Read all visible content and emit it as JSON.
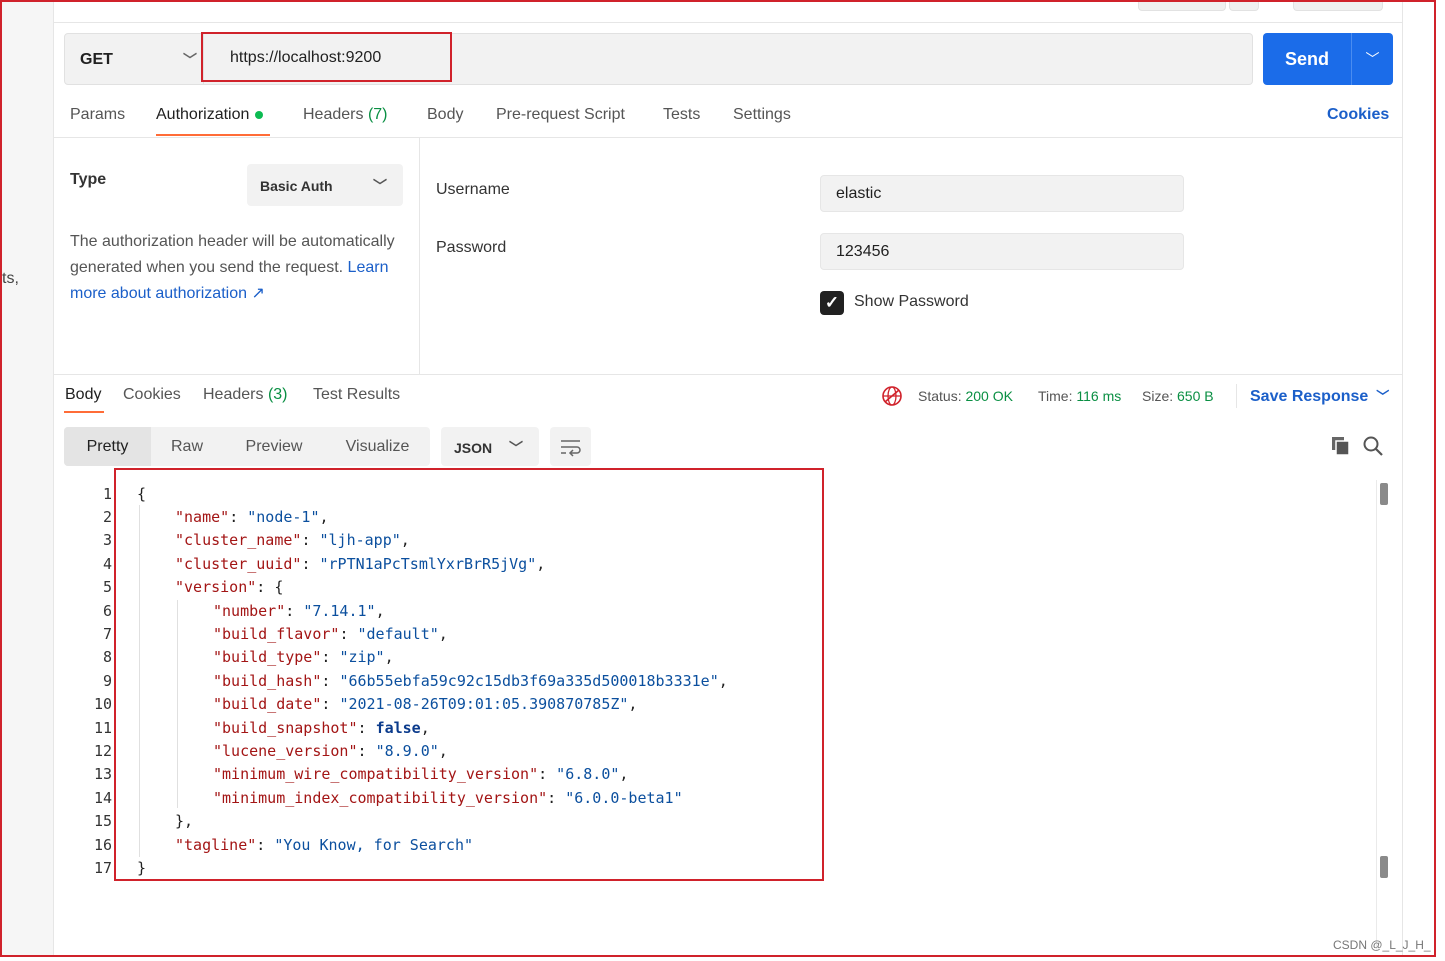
{
  "request": {
    "method": "GET",
    "url": "https://localhost:9200",
    "send_label": "Send"
  },
  "tabs": [
    {
      "label": "Params"
    },
    {
      "label": "Authorization"
    },
    {
      "label": "Headers",
      "count": "(7)"
    },
    {
      "label": "Body"
    },
    {
      "label": "Pre-request Script"
    },
    {
      "label": "Tests"
    },
    {
      "label": "Settings"
    }
  ],
  "cookies_label": "Cookies",
  "auth": {
    "type_label": "Type",
    "type_value": "Basic Auth",
    "description": "The authorization header will be automatically generated when you send the request.",
    "learn_more": "Learn more about authorization ↗",
    "username_label": "Username",
    "username_value": "elastic",
    "password_label": "Password",
    "password_value": "123456",
    "show_password_label": "Show Password"
  },
  "response": {
    "tabs": [
      {
        "label": "Body"
      },
      {
        "label": "Cookies"
      },
      {
        "label": "Headers",
        "count": "(3)"
      },
      {
        "label": "Test Results"
      }
    ],
    "status_label": "Status:",
    "status_value": "200 OK",
    "time_label": "Time:",
    "time_value": "116 ms",
    "size_label": "Size:",
    "size_value": "650 B",
    "save_response": "Save Response",
    "views": [
      "Pretty",
      "Raw",
      "Preview",
      "Visualize"
    ],
    "format": "JSON",
    "lines": [
      "1",
      "2",
      "3",
      "4",
      "5",
      "6",
      "7",
      "8",
      "9",
      "10",
      "11",
      "12",
      "13",
      "14",
      "15",
      "16",
      "17"
    ],
    "body": {
      "name_key": "\"name\"",
      "name_val": "\"node-1\"",
      "cluster_name_key": "\"cluster_name\"",
      "cluster_name_val": "\"ljh-app\"",
      "cluster_uuid_key": "\"cluster_uuid\"",
      "cluster_uuid_val": "\"rPTN1aPcTsmlYxrBrR5jVg\"",
      "version_key": "\"version\"",
      "number_key": "\"number\"",
      "number_val": "\"7.14.1\"",
      "build_flavor_key": "\"build_flavor\"",
      "build_flavor_val": "\"default\"",
      "build_type_key": "\"build_type\"",
      "build_type_val": "\"zip\"",
      "build_hash_key": "\"build_hash\"",
      "build_hash_val": "\"66b55ebfa59c92c15db3f69a335d500018b3331e\"",
      "build_date_key": "\"build_date\"",
      "build_date_val": "\"2021-08-26T09:01:05.390870785Z\"",
      "build_snapshot_key": "\"build_snapshot\"",
      "build_snapshot_val": "false",
      "lucene_version_key": "\"lucene_version\"",
      "lucene_version_val": "\"8.9.0\"",
      "min_wire_key": "\"minimum_wire_compatibility_version\"",
      "min_wire_val": "\"6.8.0\"",
      "min_index_key": "\"minimum_index_compatibility_version\"",
      "min_index_val": "\"6.0.0-beta1\"",
      "tagline_key": "\"tagline\"",
      "tagline_val": "\"You Know, for Search\""
    }
  },
  "left_gutter_text": "ts,",
  "watermark": "CSDN @_L_J_H_",
  "colors": {
    "accent_send": "#1b6ce9",
    "tab_underline": "#ff6c37",
    "status_green": "#0a8f43",
    "link_blue": "#1b5fc9",
    "highlight_red": "#d0222b"
  }
}
